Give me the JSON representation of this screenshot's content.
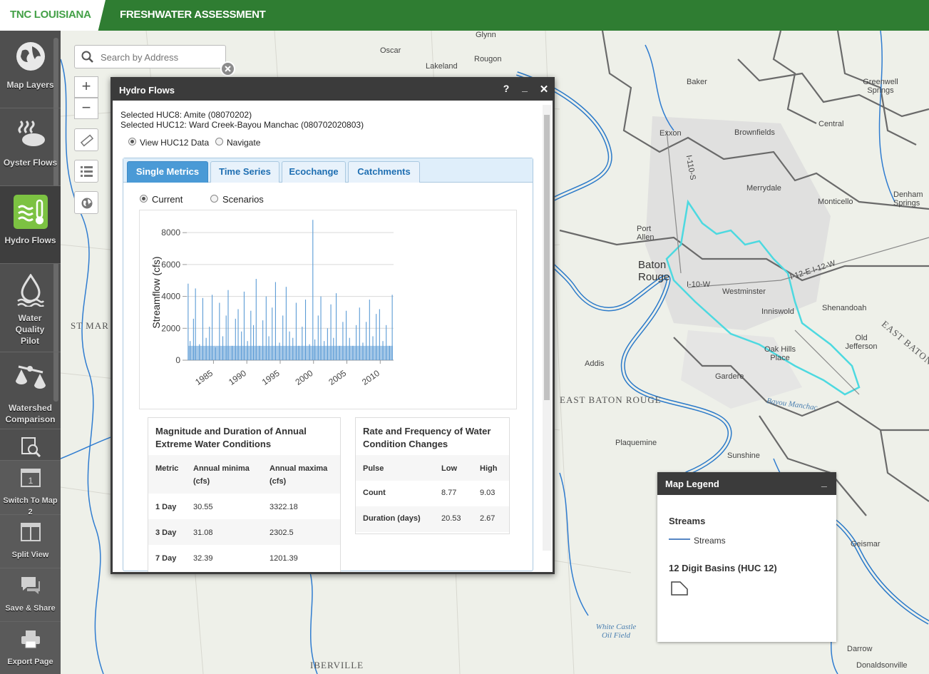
{
  "header": {
    "brand": "TNC LOUISIANA",
    "title": "FRESHWATER ASSESSMENT"
  },
  "sidebar": {
    "items": [
      {
        "label": "Map Layers",
        "icon": "globe-icon"
      },
      {
        "label": "Oyster Flows",
        "icon": "oyster-icon"
      },
      {
        "label": "Hydro Flows",
        "icon": "hydro-thermometer-icon",
        "active": true
      },
      {
        "label": "Water Quality Pilot",
        "icon": "water-drop-icon"
      },
      {
        "label": "Watershed Comparison",
        "icon": "scales-icon"
      },
      {
        "label": "",
        "icon": "magnifier-report-icon"
      }
    ],
    "tools": [
      {
        "label": "Switch To Map 2",
        "icon": "map-two-icon"
      },
      {
        "label": "Split View",
        "icon": "split-view-icon"
      },
      {
        "label": "Save & Share",
        "icon": "chat-bubbles-icon"
      },
      {
        "label": "Export Page",
        "icon": "printer-icon"
      }
    ]
  },
  "map_controls": {
    "search_placeholder": "Search by Address",
    "zoom_in": "+",
    "zoom_out": "−"
  },
  "map_labels": [
    {
      "text": "Glynn"
    },
    {
      "text": "Oscar"
    },
    {
      "text": "Lakeland"
    },
    {
      "text": "Rougon"
    },
    {
      "text": "Baker"
    },
    {
      "text": "Greenwell Springs"
    },
    {
      "text": "Exxon"
    },
    {
      "text": "Brownfields"
    },
    {
      "text": "Central"
    },
    {
      "text": "Merrydale"
    },
    {
      "text": "Monticello"
    },
    {
      "text": "Denham Springs"
    },
    {
      "text": "Port Allen"
    },
    {
      "text": "Baton Rouge"
    },
    {
      "text": "Westminster"
    },
    {
      "text": "Shenandoah"
    },
    {
      "text": "Inniswold"
    },
    {
      "text": "Old Jefferson"
    },
    {
      "text": "Oak Hills Place"
    },
    {
      "text": "Addis"
    },
    {
      "text": "Gardere"
    },
    {
      "text": "Plaquemine"
    },
    {
      "text": "Sunshine"
    },
    {
      "text": "Geismar"
    },
    {
      "text": "Darrow"
    },
    {
      "text": "Donaldsonville"
    },
    {
      "text": "White Castle Oil Field"
    },
    {
      "text": "EAST BATON ROUGE"
    },
    {
      "text": "IBERVILLE"
    },
    {
      "text": "ST MAR"
    },
    {
      "text": "EAST BATON"
    },
    {
      "text": "Bayou Manchac"
    },
    {
      "text": "I-10-W"
    },
    {
      "text": "I-12-E I-12-W"
    },
    {
      "text": "I-110-S"
    }
  ],
  "hydro_panel": {
    "title": "Hydro Flows",
    "help": "?",
    "minimize": "_",
    "close": "✕",
    "selected_huc8": "Selected HUC8: Amite (08070202)",
    "selected_huc12": "Selected HUC12: Ward Creek-Bayou Manchac (080702020803)",
    "mode_options": [
      {
        "label": "View HUC12 Data",
        "checked": true
      },
      {
        "label": "Navigate",
        "checked": false
      }
    ],
    "tabs": [
      {
        "label": "Single Metrics",
        "active": true
      },
      {
        "label": "Time Series",
        "active": false
      },
      {
        "label": "Ecochange",
        "active": false
      },
      {
        "label": "Catchments",
        "active": false
      }
    ],
    "scenario_options": [
      {
        "label": "Current",
        "checked": true
      },
      {
        "label": "Scenarios",
        "checked": false
      }
    ],
    "magnitude": {
      "title_line1": "Magnitude and Duration of Annual",
      "title_line2": "Extreme Water Conditions",
      "headers": [
        "Metric",
        "Annual minima",
        "(cfs)",
        "Annual maxima",
        "(cfs)"
      ],
      "rows": [
        {
          "metric": "1 Day",
          "min": "30.55",
          "max": "3322.18"
        },
        {
          "metric": "3 Day",
          "min": "31.08",
          "max": "2302.5"
        },
        {
          "metric": "7 Day",
          "min": "32.39",
          "max": "1201.39"
        }
      ]
    },
    "rate": {
      "title_line1": "Rate and Frequency of Water",
      "title_line2": "Condition Changes",
      "headers": [
        "Pulse",
        "Low",
        "High"
      ],
      "rows": [
        {
          "name": "Count",
          "low": "8.77",
          "high": "9.03"
        },
        {
          "name": "Duration (days)",
          "low": "20.53",
          "high": "2.67"
        }
      ]
    }
  },
  "chart_data": {
    "type": "line",
    "title": "",
    "xlabel": "",
    "ylabel": "Streamflow (cfs)",
    "x_ticks": [
      "1985",
      "1990",
      "1995",
      "2000",
      "2005",
      "2010"
    ],
    "y_ticks": [
      "0",
      "2000",
      "4000",
      "6000",
      "8000"
    ],
    "xlim": [
      1981,
      2012
    ],
    "ylim": [
      0,
      8500
    ],
    "grid": true,
    "color": "#5b9bd5",
    "series": [
      {
        "name": "",
        "x": [
          1981.2,
          1981.5,
          1982.0,
          1982.3,
          1982.9,
          1983.4,
          1983.9,
          1984.4,
          1984.8,
          1985.3,
          1985.9,
          1986.4,
          1986.9,
          1987.2,
          1987.8,
          1988.3,
          1988.7,
          1989.2,
          1989.6,
          1990.1,
          1990.6,
          1991.0,
          1991.4,
          1991.9,
          1992.4,
          1992.9,
          1993.3,
          1993.8,
          1994.3,
          1994.9,
          1995.4,
          1995.9,
          1996.4,
          1996.9,
          1997.4,
          1997.8,
          1998.3,
          1998.8,
          1999.4,
          1999.9,
          2000.2,
          2000.7,
          2001.1,
          2001.6,
          2002.1,
          2002.6,
          2003.0,
          2003.4,
          2003.9,
          2004.4,
          2004.9,
          2005.4,
          2005.9,
          2006.4,
          2006.9,
          2007.4,
          2007.9,
          2008.4,
          2008.9,
          2009.4,
          2009.9,
          2010.4,
          2010.9,
          2011.4,
          2011.8
        ],
        "y": [
          4800,
          1200,
          2600,
          4500,
          1000,
          3900,
          1400,
          2100,
          4100,
          800,
          3600,
          1500,
          2800,
          4400,
          900,
          2600,
          3200,
          1800,
          4300,
          1200,
          3100,
          2200,
          5100,
          900,
          2500,
          4000,
          1500,
          3300,
          4900,
          1100,
          2800,
          4600,
          1800,
          1400,
          3600,
          900,
          2100,
          3800,
          1000,
          8800,
          1300,
          2800,
          4000,
          1200,
          2000,
          3500,
          1400,
          4200,
          900,
          2400,
          3100,
          1400,
          900,
          2200,
          3300,
          1100,
          2400,
          3800,
          1500,
          2900,
          3200,
          1200,
          2200,
          900,
          4100
        ]
      }
    ]
  },
  "legend": {
    "title": "Map Legend",
    "minimize": "_",
    "groups": [
      {
        "title": "Streams",
        "item": "Streams",
        "color": "#1f5fb0"
      },
      {
        "title": "12 Digit Basins (HUC 12)",
        "item": ""
      }
    ]
  },
  "colors": {
    "header_green": "#2f7d32",
    "brand_green": "#43a047",
    "sidebar_bg": "#4f4f4f",
    "active_icon_green": "#7cc242",
    "huc_outline": "#4dd9e0",
    "river_blue": "#1f6fc0",
    "tab_active": "#4a9ad6"
  }
}
